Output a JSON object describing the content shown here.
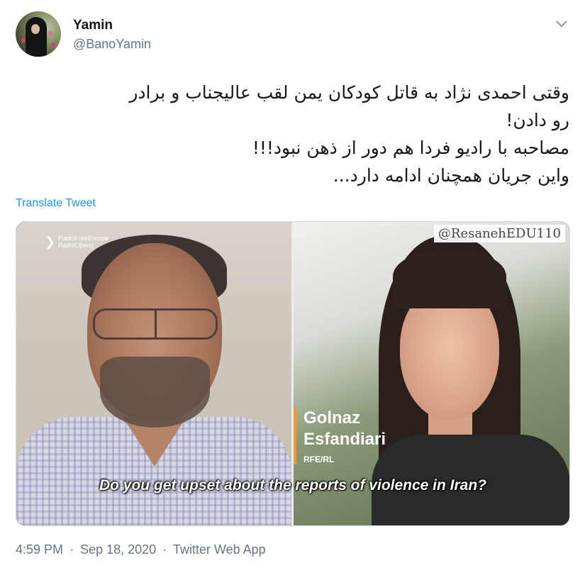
{
  "author": {
    "display_name": "Yamin",
    "handle": "@BanoYamin"
  },
  "tweet": {
    "text": "وقتی  احمدی نژاد به قاتل کودکان یمن  لقب عالیجناب و برادر\nرو دادن!\nمصاحبه با رادیو فردا هم دور از ذهن نبود!!!\nواین جریان همچنان ادامه دارد...",
    "translate_label": "Translate Tweet"
  },
  "media": {
    "watermark": "@ResanehEDU110",
    "logo_line1": "RadioFreeEurope",
    "logo_line2": "RadioLiberty",
    "caption_first": "Golnaz",
    "caption_last": "Esfandiari",
    "caption_org": "RFE/RL",
    "subtitle": "Do you get upset about the reports of violence in Iran?"
  },
  "meta": {
    "time": "4:59 PM",
    "separator": "·",
    "date": "Sep 18, 2020",
    "source": "Twitter Web App"
  },
  "colors": {
    "link": "#1b95e0",
    "secondary_text": "#657786",
    "accent_bar": "#f29a2e"
  },
  "icons": {
    "menu": "chevron-down-icon",
    "logo": "rfe-logo-icon"
  }
}
